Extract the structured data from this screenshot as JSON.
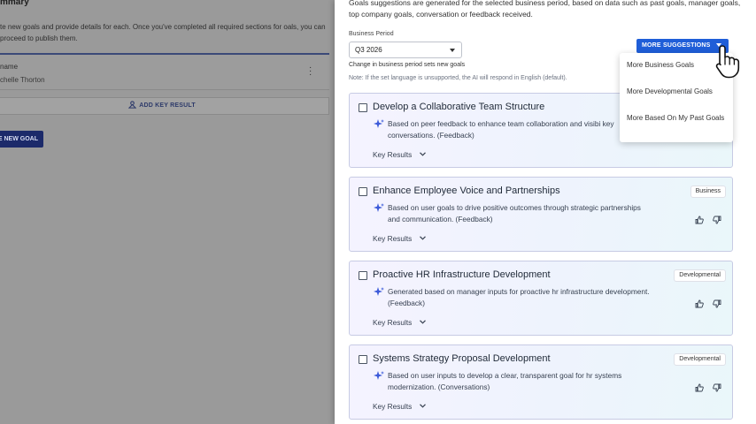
{
  "background_page": {
    "title": "mmary",
    "description": "te new goals and provide details for each. Once you've completed all required sections for oals, you can proceed to publish them.",
    "card_label": "name",
    "card_value": "chelle Thorton",
    "add_key_result_label": "ADD KEY RESULT",
    "new_goal_label": "E NEW GOAL"
  },
  "drawer": {
    "intro": "Goals suggestions are generated for the selected business period, based on data such as past goals, manager goals, top company goals, conversation or feedback received.",
    "business_period": {
      "label": "Business Period",
      "value": "Q3 2026",
      "helper": "Change in business period sets new goals"
    },
    "language_note": "Note: If the set language is unsupported, the AI will respond in English (default).",
    "more_suggestions": {
      "label": "MORE SUGGESTIONS",
      "menu_items": [
        "More Business Goals",
        "More Developmental Goals",
        "More Based On My Past Goals"
      ]
    },
    "goals": [
      {
        "title": "Develop a Collaborative Team Structure",
        "description": "Based on peer feedback to enhance team collaboration and visibi key conversations. (Feedback)",
        "badge": "",
        "key_results_label": "Key Results"
      },
      {
        "title": "Enhance Employee Voice and Partnerships",
        "description": "Based on user goals to drive positive outcomes through strategic partnerships and communication. (Feedback)",
        "badge": "Business",
        "key_results_label": "Key Results"
      },
      {
        "title": "Proactive HR Infrastructure Development",
        "description": "Generated based on manager inputs for proactive hr infrastructure development. (Feedback)",
        "badge": "Developmental",
        "key_results_label": "Key Results"
      },
      {
        "title": "Systems Strategy Proposal Development",
        "description": "Based on user inputs to develop a clear, transparent goal for hr systems modernization. (Conversations)",
        "badge": "Developmental",
        "key_results_label": "Key Results"
      }
    ]
  },
  "colors": {
    "primary_button": "#1f5ed8",
    "overlay_dim": "#9a9a9a",
    "card_border": "#c7cbe4",
    "sparkle": "#3d5bd9"
  },
  "icons": [
    "kebab-menu-icon",
    "key-result-icon",
    "caret-down-icon",
    "checkbox-icon",
    "sparkle-icon",
    "chevron-down-icon",
    "thumbs-up-icon",
    "thumbs-down-icon",
    "hand-pointer-cursor-icon"
  ]
}
